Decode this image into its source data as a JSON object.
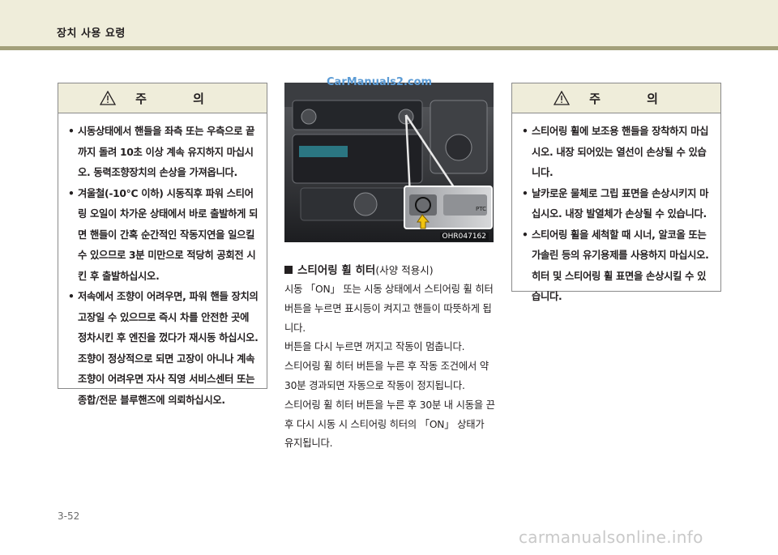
{
  "header": {
    "title": "장치 사용 요령"
  },
  "caution_left": {
    "title": "주 의",
    "items": [
      "시동상태에서 핸들을 좌측 또는 우측으로 끝까지 돌려 10초 이상 계속 유지하지 마십시오. 동력조향장치의 손상을 가져옵니다.",
      "겨울철(-10℃ 이하) 시동직후 파워 스티어링 오일이 차가운 상태에서 바로 출발하게 되면 핸들이 간혹 순간적인 작동지연을 일으킬 수 있으므로 3분 미만으로 적당히 공회전 시킨 후 출발하십시오.",
      "저속에서 조향이 어려우면, 파워 핸들 장치의 고장일 수 있으므로 즉시 차를 안전한 곳에 정차시킨 후 엔진을 껐다가 재시동 하십시오. 조향이 정상적으로 되면 고장이 아니나 계속 조향이 어려우면 자사 직영 서비스센터 또는 종합/전문 블루핸즈에 의뢰하십시오."
    ]
  },
  "photo": {
    "code": "OHR047162",
    "button_label": "PTC"
  },
  "watermark_top": "CarManuals2.com",
  "section": {
    "title": "스티어링 휠 히터",
    "subtitle": "(사양 적용시)",
    "paragraphs": [
      "시동 「ON」 또는 시동 상태에서 스티어링 휠 히터 버튼을 누르면 표시등이 켜지고 핸들이 따뜻하게 됩니다.",
      "버튼을 다시 누르면 꺼지고 작동이 멈춥니다.",
      "스티어링 휠 히터 버튼을 누른 후 작동 조건에서 약 30분 경과되면 자동으로 작동이 정지됩니다.",
      "스티어링 휠 히터 버튼을 누른 후 30분 내 시동을 끈 후 다시 시동 시 스티어링 히터의 「ON」 상태가 유지됩니다."
    ]
  },
  "caution_right": {
    "title": "주 의",
    "items": [
      "스티어링 휠에 보조용 핸들을 장착하지 마십시오. 내장 되어있는 열선이 손상될 수 있습니다.",
      "날카로운 물체로 그립 표면을 손상시키지 마십시오. 내장 발열체가 손상될 수 있습니다.",
      "스티어링 휠을 세척할 때 시너, 알코올 또는 가솔린 등의 유기용제를 사용하지 마십시오. 히터 및 스티어링 휠 표면을 손상시킬 수 있습니다."
    ]
  },
  "page_number": "3-52",
  "footer_watermark": "carmanualsonline.info"
}
